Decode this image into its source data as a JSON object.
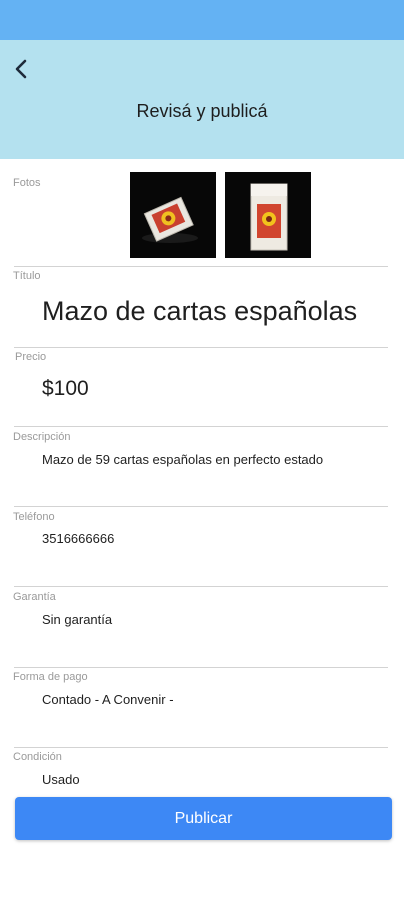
{
  "header": {
    "title": "Revisá y publicá",
    "back_icon": "chevron-left-icon"
  },
  "colors": {
    "status_bar": "#64b2f3",
    "header_bg": "#b4e1ef",
    "button_bg": "#3d88f5",
    "label": "#9a9a9a"
  },
  "fields": {
    "fotos": {
      "label": "Fotos"
    },
    "titulo": {
      "label": "Título",
      "value": "Mazo de cartas españolas"
    },
    "precio": {
      "label": "Precio",
      "value": "$100"
    },
    "descripcion": {
      "label": "Descripción",
      "value": "Mazo de 59 cartas españolas en perfecto estado"
    },
    "telefono": {
      "label": "Teléfono",
      "value": "3516666666"
    },
    "garantia": {
      "label": "Garantía",
      "value": "Sin garantía"
    },
    "forma_pago": {
      "label": "Forma de pago",
      "value": "Contado - A Convenir -"
    },
    "condicion": {
      "label": "Condición",
      "value": "Usado"
    }
  },
  "actions": {
    "publish_label": "Publicar"
  }
}
